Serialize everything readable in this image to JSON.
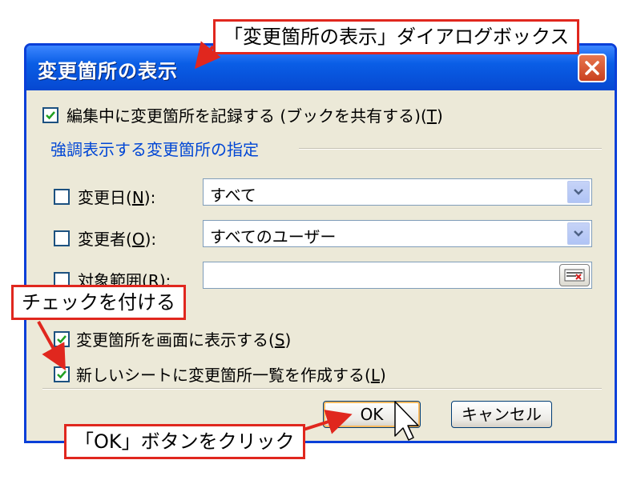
{
  "dialog": {
    "title": "変更箇所の表示",
    "track_changes": {
      "checked": true,
      "label": "編集中に変更箇所を記録する (ブックを共有する)",
      "shortcut": "T"
    },
    "group_title": "強調表示する変更箇所の指定",
    "when": {
      "checked": false,
      "label": "変更日",
      "shortcut": "N",
      "value": "すべて"
    },
    "who": {
      "checked": false,
      "label": "変更者",
      "shortcut": "O",
      "value": "すべてのユーザー"
    },
    "where": {
      "checked": false,
      "label": "対象範囲",
      "shortcut": "R",
      "value": ""
    },
    "highlight_onscreen": {
      "checked": true,
      "label": "変更箇所を画面に表示する",
      "shortcut": "S"
    },
    "list_new_sheet": {
      "checked": true,
      "label": "新しいシートに変更箇所一覧を作成する",
      "shortcut": "L"
    },
    "ok_label": "OK",
    "cancel_label": "キャンセル"
  },
  "annotations": {
    "dialog_callout": "「変更箇所の表示」ダイアログボックス",
    "check_callout": "チェックを付ける",
    "ok_callout": "「OK」ボタンをクリック"
  },
  "colors": {
    "titlebar": "#0a5ee6",
    "dialog_bg": "#ece9d8",
    "group_title": "#0046d5",
    "callout_border": "#e0271e",
    "check": "#21a121"
  }
}
